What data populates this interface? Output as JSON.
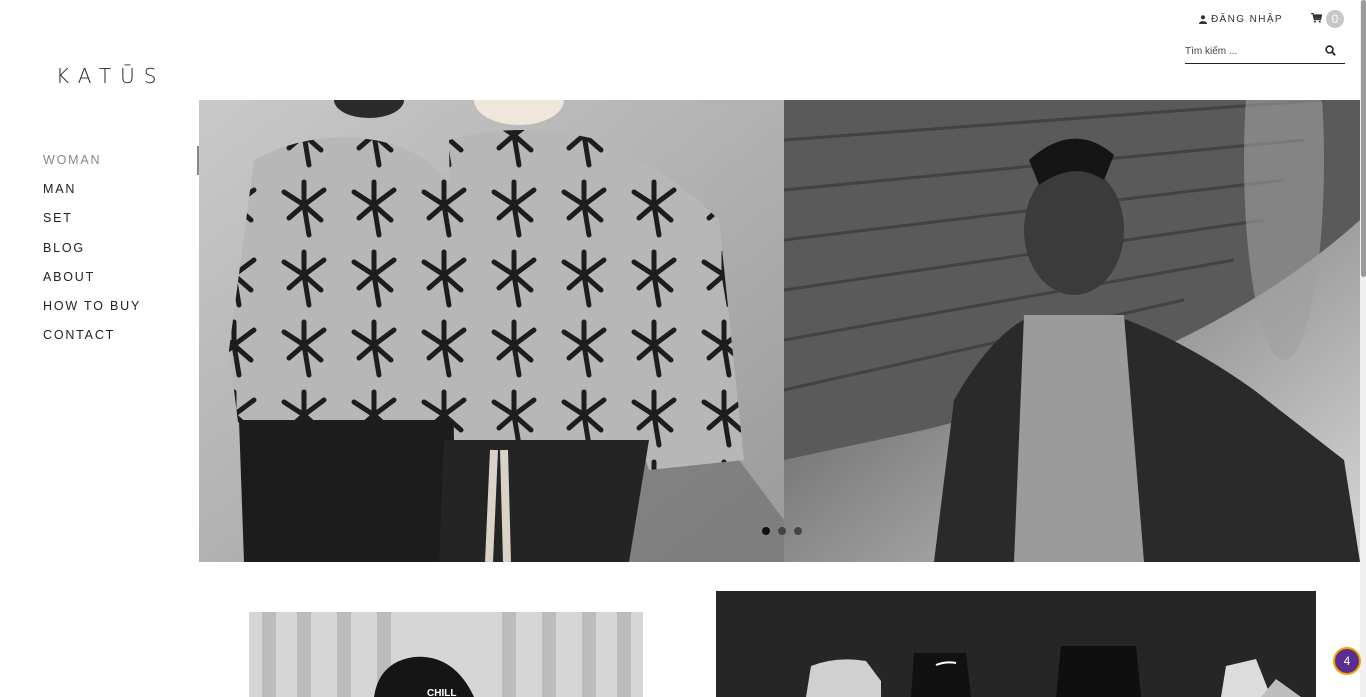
{
  "header": {
    "login_label": "ĐĂNG NHẬP",
    "cart_count": "0"
  },
  "search": {
    "placeholder": "Tìm kiếm ..."
  },
  "logo": {
    "text": "KATŪS"
  },
  "nav": {
    "items": [
      {
        "label": "WOMAN"
      },
      {
        "label": "MAN"
      },
      {
        "label": "SET"
      },
      {
        "label": "BLOG"
      },
      {
        "label": "ABOUT"
      },
      {
        "label": "HOW TO BUY"
      },
      {
        "label": "CONTACT"
      }
    ],
    "active_index": 0
  },
  "slider": {
    "slide_count": 3,
    "active_slide": 1
  },
  "floating_badge": {
    "count": "4"
  },
  "colors": {
    "text": "#222222",
    "active_nav": "#888888",
    "cart_bubble": "#c7c7c7",
    "badge_bg": "#5a2d91",
    "badge_ring": "#f0a500"
  }
}
